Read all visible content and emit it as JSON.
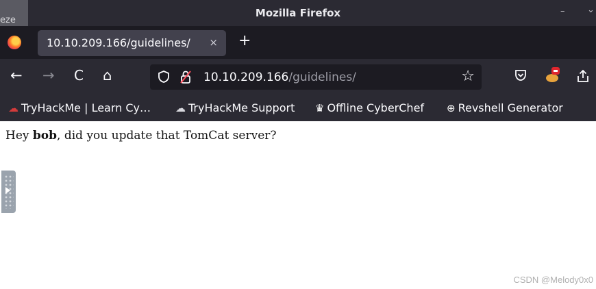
{
  "window": {
    "title": "Mozilla Firefox",
    "ghost_text": "eze",
    "minimize_glyph": "–",
    "restore_glyph": "⌄"
  },
  "tabs": [
    {
      "label": "10.10.209.166/guidelines/",
      "close_glyph": "×",
      "active": true
    }
  ],
  "new_tab_glyph": "+",
  "navbar": {
    "back_glyph": "←",
    "forward_glyph": "→",
    "reload_glyph": "C",
    "home_glyph": "⌂",
    "url_host": "10.10.209.166",
    "url_path": "/guidelines/",
    "bookmark_star_glyph": "☆"
  },
  "bookmarks": [
    {
      "icon": "tryhackme-icon",
      "glyph": "☁",
      "label": "TryHackMe | Learn Cy…"
    },
    {
      "icon": "cloud-icon",
      "glyph": "☁",
      "label": "TryHackMe Support"
    },
    {
      "icon": "chef-hat-icon",
      "glyph": "♛",
      "label": "Offline CyberChef"
    },
    {
      "icon": "globe-icon",
      "glyph": "⊕",
      "label": "Revshell Generator"
    }
  ],
  "page": {
    "text_before": "Hey ",
    "bold_name": "bob",
    "text_after": ", did you update that TomCat server?"
  },
  "watermark": "CSDN @Melody0x0",
  "colors": {
    "toolbar_bg": "#2b2a33",
    "tabstrip_bg": "#1c1b22",
    "active_tab_bg": "#42414d",
    "urlbar_bg": "#1c1b22",
    "insecure_lock_red": "#ff4f5e"
  }
}
